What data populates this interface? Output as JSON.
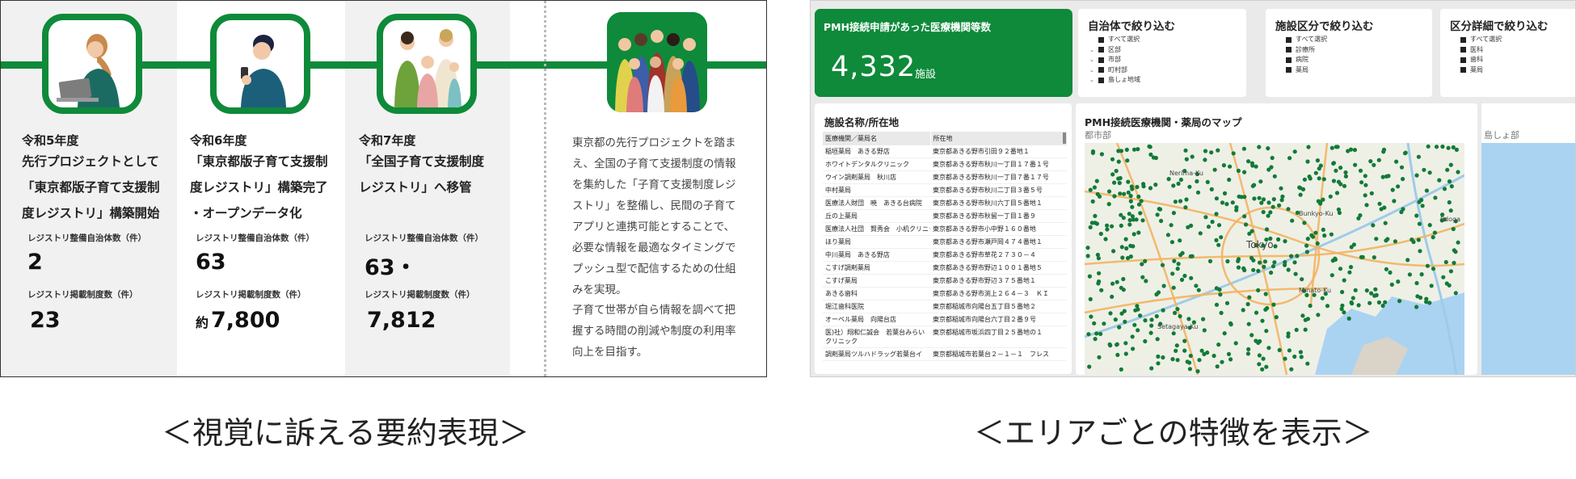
{
  "left": {
    "steps": [
      {
        "year": "令和5年度",
        "desc": [
          "先行プロジェクトとして",
          "「東京都版子育て支援制",
          "度レジストリ」構築開始"
        ],
        "stat1_label": "レジストリ整備自治体数（件）",
        "stat1_value": "2",
        "stat2_label": "レジストリ掲載制度数（件）",
        "stat2_prefix": "",
        "stat2_value": "23"
      },
      {
        "year": "令和6年度",
        "desc": [
          "「東京都版子育て支援制",
          "度レジストリ」構築完了",
          "・オープンデータ化"
        ],
        "stat1_label": "レジストリ整備自治体数（件）",
        "stat1_value": "63",
        "stat2_label": "レジストリ掲載制度数（件）",
        "stat2_prefix": "約",
        "stat2_value": "7,800"
      },
      {
        "year": "令和7年度",
        "desc": [
          "「全国子育て支援制度",
          "レジストリ」へ移管"
        ],
        "stat1_label": "レジストリ整備自治体数（件）",
        "stat1_value": "63・",
        "stat2_label": "レジストリ掲載制度数（件）",
        "stat2_prefix": "",
        "stat2_value": "7,812"
      }
    ],
    "right_text_1": [
      "東京都の先行プロジェクトを踏ま",
      "え、全国の子育て支援制度の情報",
      "を集約した「子育て支援制度レジ",
      "ストリ」を整備し、民間の子育て",
      "アプリと連携可能とすることで、",
      "必要な情報を最適なタイミングで",
      "プッシュ型で配信するための仕組",
      "みを実現。"
    ],
    "right_text_2": [
      "子育て世帯が自ら情報を調べて把",
      "握する時間の削減や制度の利用率",
      "向上を目指す。"
    ]
  },
  "right": {
    "kpi": {
      "title": "PMH接続申請があった医療機関等数",
      "value": "4,332",
      "unit": "施設"
    },
    "filters": [
      {
        "title": "自治体で絞り込む",
        "items": [
          {
            "chev": "",
            "label": "すべて選択"
          },
          {
            "chev": "⌄",
            "label": "区部"
          },
          {
            "chev": "⌄",
            "label": "市部"
          },
          {
            "chev": "⌄",
            "label": "町村部"
          },
          {
            "chev": "⌄",
            "label": "島しょ地域"
          }
        ]
      },
      {
        "title": "施設区分で絞り込む",
        "items": [
          {
            "chev": "",
            "label": "すべて選択"
          },
          {
            "chev": "",
            "label": "診療所"
          },
          {
            "chev": "",
            "label": "病院"
          },
          {
            "chev": "",
            "label": "薬局"
          }
        ]
      },
      {
        "title": "区分詳細で絞り込む",
        "items": [
          {
            "chev": "",
            "label": "すべて選択"
          },
          {
            "chev": "",
            "label": "医科"
          },
          {
            "chev": "",
            "label": "歯科"
          },
          {
            "chev": "",
            "label": "薬局"
          }
        ]
      }
    ],
    "list": {
      "title": "施設名称/所在地",
      "headers": [
        "医療機関／薬局名",
        "所在地"
      ],
      "rows": [
        [
          "稲垣薬局　あきる野店",
          "東京都あきる野市引田９２番地１"
        ],
        [
          "ホワイトデンタルクリニック",
          "東京都あきる野市秋川一丁目１７番１号"
        ],
        [
          "ウイン調剤薬局　秋川店",
          "東京都あきる野市秋川一丁目７番１７号"
        ],
        [
          "中村薬局",
          "東京都あきる野市秋川二丁目３番５号"
        ],
        [
          "医療法人財団　暁　あきる台病院",
          "東京都あきる野市秋川六丁目５番地１"
        ],
        [
          "丘の上薬局",
          "東京都あきる野市秋留一丁目１番９"
        ],
        [
          "医療法人社団　賢秀会　小机クリニック",
          "東京都あきる野市小中野１６０番地"
        ],
        [
          "ほり薬局",
          "東京都あきる野市瀬戸岡４７４番地１"
        ],
        [
          "中川薬局　あきる野店",
          "東京都あきる野市草花２７３０－４"
        ],
        [
          "こすげ調剤薬局",
          "東京都あきる野市野辺１００１番地５"
        ],
        [
          "こすげ薬局",
          "東京都あきる野市野辺３７５番地１"
        ],
        [
          "あきる歯科",
          "東京都あきる野市渕上２６４－３　ＫＩ"
        ],
        [
          "堀江歯科医院",
          "東京都稲城市向陽台五丁目５番地２"
        ],
        [
          "オーベル薬局　向陽台店",
          "東京都稲城市向陽台六丁目２番９号"
        ],
        [
          "医)社）翔和仁誠会　若葉台みらいクリニック",
          "東京都稲城市坂浜四丁目２５番地の１"
        ],
        [
          "調剤薬局ツルハドラッグ若葉台イ",
          "東京都稲城市若葉台２－１－１　フレス"
        ]
      ]
    },
    "map": {
      "title": "PMH接続医療機関・薬局のマップ",
      "subtitle": "都市部",
      "labels": [
        "Nerima-Ku",
        "Bunkyo-Ku",
        "Tokyo",
        "Minato-Ku",
        "Setagaya-Ku",
        "Edoga"
      ],
      "side_subtitle": "島しょ部"
    }
  },
  "captions": {
    "left": "＜視覚に訴える要約表現＞",
    "right": "＜エリアごとの特徴を表示＞"
  },
  "colors": {
    "brand_green": "#0e8a3a",
    "map_dot": "#127a38",
    "sea": "#aad3f2"
  }
}
